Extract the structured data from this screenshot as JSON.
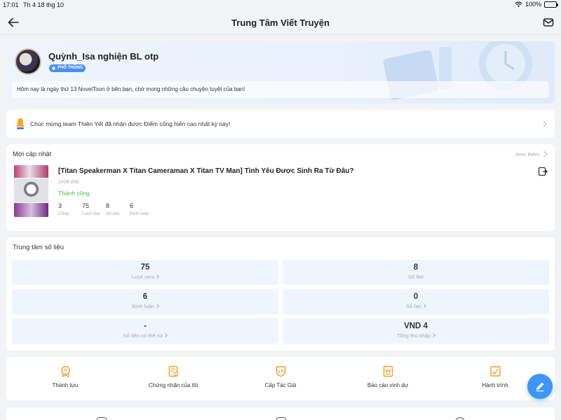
{
  "status_bar": {
    "time": "17:01",
    "date": "Th 4 18 thg 10",
    "battery": "100%"
  },
  "header": {
    "title": "Trung Tâm Viết Truyện"
  },
  "profile": {
    "username": "Quỳnh_Isa nghiện BL otp",
    "level_badge": "PHỔ THÔNG",
    "greeting": "Hôm nay là ngày thứ 13 NovelToon ở bên bạn, chờ mong những câu chuyện tuyệt của bạn!"
  },
  "notice": {
    "text": "Chúc mừng team Thiên Yết đã nhận được Điểm cống hiến cao nhất kỳ này!"
  },
  "recent": {
    "section_title": "Mới cập nhật",
    "see_more": "Xem thêm",
    "story": {
      "title": "[Titan Speakerman X Titan Cameraman X Titan TV Man] Tình Yêu Được Sinh Ra Từ Đâu?",
      "word_count": "2428 chữ",
      "status": "Thành công",
      "stats": [
        {
          "value": "3",
          "label": "Chap"
        },
        {
          "value": "75",
          "label": "Lượt đọc"
        },
        {
          "value": "8",
          "label": "Số like"
        },
        {
          "value": "6",
          "label": "Bình luận"
        }
      ]
    }
  },
  "data_center": {
    "section_title": "Trung tâm số liệu",
    "tiles": [
      {
        "value": "75",
        "label": "Lượt xem"
      },
      {
        "value": "8",
        "label": "Số like"
      },
      {
        "value": "6",
        "label": "Bình luận"
      },
      {
        "value": "0",
        "label": "Số fan"
      },
      {
        "value": "-",
        "label": "Số tiền có thể rút"
      },
      {
        "value": "VND 4",
        "label": "Tổng thu nhập"
      }
    ]
  },
  "tools": [
    {
      "label": "Thành tựu",
      "icon": "achievement-icon"
    },
    {
      "label": "Chứng nhận của tôi",
      "icon": "certificate-icon"
    },
    {
      "label": "Cấp Tác Giả",
      "icon": "author-level-icon"
    },
    {
      "label": "Báo cáo vinh dự",
      "icon": "honor-report-icon"
    },
    {
      "label": "Hành trình",
      "icon": "journey-icon"
    }
  ],
  "colors": {
    "accent": "#3d96f5",
    "success": "#3fbf3f",
    "tool_icon": "#f0a030",
    "tile_bg": "#eef5fd"
  }
}
